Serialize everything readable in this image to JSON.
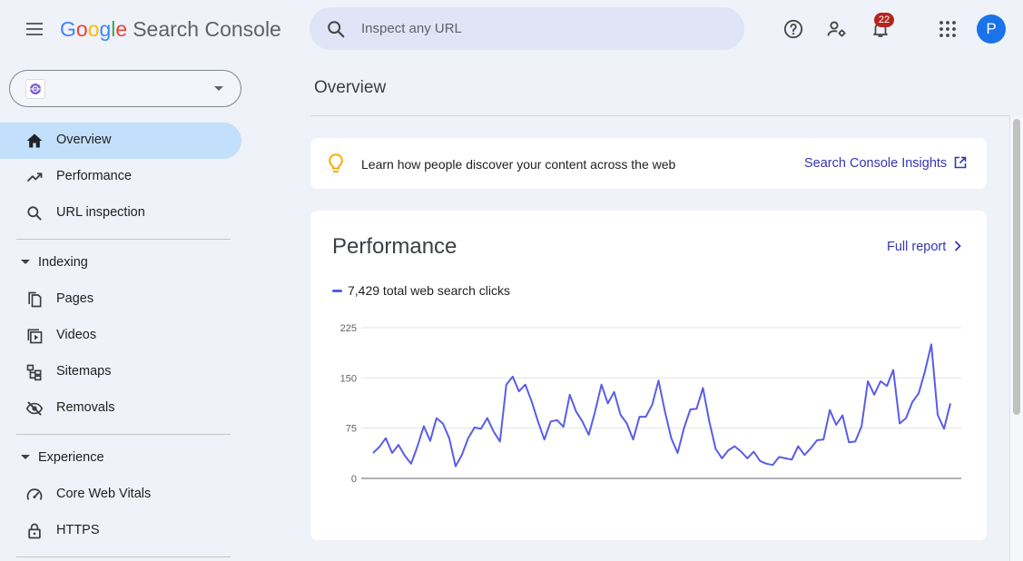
{
  "header": {
    "logo_letters": [
      "G",
      "o",
      "o",
      "g",
      "l",
      "e"
    ],
    "product_name": "Search Console",
    "search_placeholder": "Inspect any URL",
    "notification_count": "22",
    "avatar_letter": "P"
  },
  "sidebar": {
    "property_selector_value": "",
    "primary_items": [
      {
        "label": "Overview",
        "icon": "home-icon",
        "active": true
      },
      {
        "label": "Performance",
        "icon": "trending-up-icon"
      },
      {
        "label": "URL inspection",
        "icon": "search-icon"
      }
    ],
    "sections": [
      {
        "label": "Indexing",
        "items": [
          {
            "label": "Pages",
            "icon": "pages-icon"
          },
          {
            "label": "Videos",
            "icon": "video-icon"
          },
          {
            "label": "Sitemaps",
            "icon": "sitemap-icon"
          },
          {
            "label": "Removals",
            "icon": "visibility-off-icon"
          }
        ]
      },
      {
        "label": "Experience",
        "items": [
          {
            "label": "Core Web Vitals",
            "icon": "speed-icon"
          },
          {
            "label": "HTTPS",
            "icon": "lock-icon"
          }
        ]
      }
    ]
  },
  "main": {
    "page_title": "Overview",
    "insights_banner": {
      "text": "Learn how people discover your content across the web",
      "link": "Search Console Insights"
    },
    "performance_card": {
      "title": "Performance",
      "full_report": "Full report",
      "legend": "7,429 total web search clicks"
    }
  },
  "colors": {
    "accent_link": "#3535b4",
    "series_line": "#5a5ce8",
    "active_nav": "#c2e0fb",
    "badge": "#b3261e",
    "avatar": "#1a73e8"
  },
  "chart_data": {
    "type": "line",
    "ylim": [
      0,
      225
    ],
    "yticks": [
      "0",
      "75",
      "150",
      "225"
    ],
    "grid": true,
    "series": [
      {
        "name": "7,429 total web search clicks",
        "values": [
          38,
          47,
          60,
          38,
          50,
          34,
          22,
          48,
          78,
          56,
          90,
          82,
          60,
          18,
          35,
          60,
          76,
          74,
          90,
          70,
          55,
          140,
          152,
          130,
          140,
          115,
          85,
          58,
          85,
          87,
          77,
          125,
          100,
          85,
          65,
          100,
          140,
          112,
          129,
          95,
          82,
          58,
          92,
          92,
          110,
          146,
          100,
          60,
          38,
          75,
          103,
          104,
          135,
          85,
          44,
          30,
          42,
          48,
          40,
          30,
          40,
          26,
          22,
          20,
          32,
          30,
          28,
          48,
          35,
          45,
          57,
          58,
          102,
          80,
          94,
          54,
          55,
          78,
          145,
          125,
          145,
          138,
          162,
          82,
          90,
          114,
          127,
          160,
          200,
          95,
          74,
          112
        ]
      }
    ]
  }
}
